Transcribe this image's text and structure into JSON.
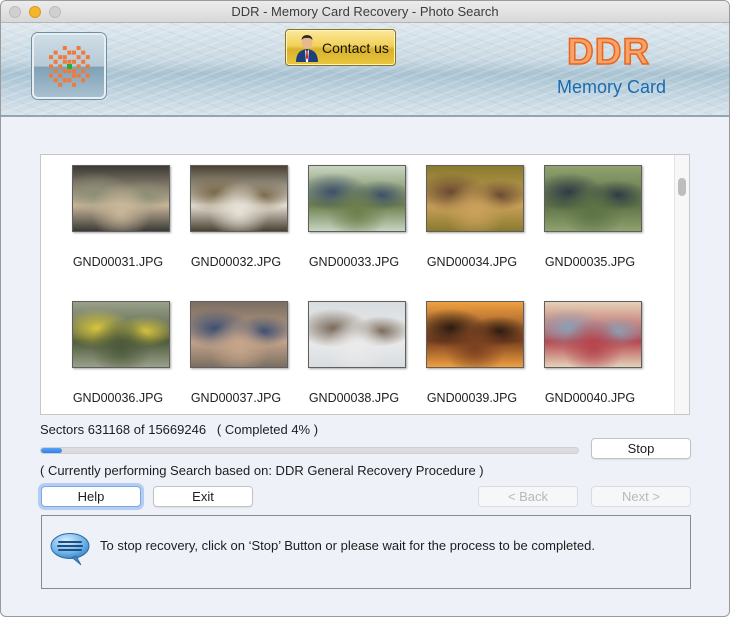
{
  "window": {
    "title": "DDR - Memory Card Recovery - Photo Search",
    "controls": [
      "close",
      "minimize",
      "maximize"
    ]
  },
  "banner": {
    "logo_icon": "ddr-starburst-logo-icon",
    "contact_button": {
      "label": "Contact us",
      "icon": "person-icon"
    },
    "brand_title": "DDR",
    "brand_subtitle": "Memory Card",
    "colors": {
      "brand_orange": "#e8641f",
      "brand_blue": "#1a6bb0",
      "contact_gold": "#f2d15a"
    }
  },
  "thumbnails": [
    {
      "filename": "GND00031.JPG",
      "scene": "friends in car",
      "palette": [
        "#3b3a36",
        "#c9b79a",
        "#8b8f77"
      ]
    },
    {
      "filename": "GND00032.JPG",
      "scene": "group of friends in forest",
      "palette": [
        "#4a4231",
        "#e7e1d6",
        "#7a6a4a"
      ]
    },
    {
      "filename": "GND00033.JPG",
      "scene": "hikers in meadow",
      "palette": [
        "#c7d5c0",
        "#6d7f4c",
        "#3e4f6b"
      ]
    },
    {
      "filename": "GND00034.JPG",
      "scene": "two women hugging",
      "palette": [
        "#8a7a2e",
        "#caa15a",
        "#6b4a32"
      ]
    },
    {
      "filename": "GND00035.JPG",
      "scene": "two men on grass",
      "palette": [
        "#8fa26f",
        "#5d7245",
        "#2f3a46"
      ]
    },
    {
      "filename": "GND00036.JPG",
      "scene": "couple by pickup truck",
      "palette": [
        "#9aa08a",
        "#4d5a3a",
        "#d7c43c"
      ]
    },
    {
      "filename": "GND00037.JPG",
      "scene": "couple at table",
      "palette": [
        "#7a6e62",
        "#c6a58a",
        "#3d4f73"
      ]
    },
    {
      "filename": "GND00038.JPG",
      "scene": "friends in car front seat",
      "palette": [
        "#d9dde0",
        "#eaeaea",
        "#7a6a5a"
      ]
    },
    {
      "filename": "GND00039.JPG",
      "scene": "friends in jeep at sunset",
      "palette": [
        "#f0a040",
        "#7a4020",
        "#2a1a12"
      ]
    },
    {
      "filename": "GND00040.JPG",
      "scene": "friends cheering outdoors",
      "palette": [
        "#e4d2b8",
        "#b5464e",
        "#8aa0b8"
      ]
    }
  ],
  "status": {
    "sectors_label": "Sectors",
    "sectors_done": "631168",
    "sectors_of": "of",
    "sectors_total": "15669246",
    "completed_text": "( Completed 4% )",
    "progress_percent": 4,
    "search_info": "( Currently performing Search based on: DDR General Recovery Procedure )"
  },
  "buttons": {
    "stop": "Stop",
    "help": "Help",
    "exit": "Exit",
    "back": "< Back",
    "next": "Next >"
  },
  "message": {
    "icon": "speech-bubble-icon",
    "text": "To stop recovery, click on ‘Stop’ Button or please wait for the process to be completed."
  }
}
